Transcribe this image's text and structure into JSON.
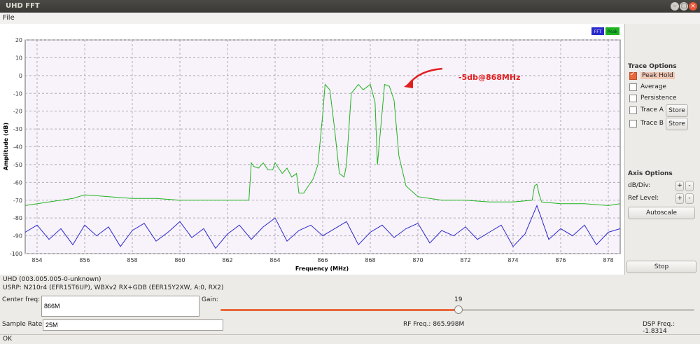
{
  "window": {
    "title": "UHD FFT"
  },
  "menu": {
    "file": "File"
  },
  "plot": {
    "legend": {
      "fft": "FFT",
      "peak": "Peak"
    },
    "annotation": "-5db@868MHz",
    "colors": {
      "fft": "#2a2acc",
      "peak": "#1fb41f",
      "annotation": "#e02020"
    }
  },
  "chart_data": {
    "type": "line",
    "xlabel": "Frequency (MHz)",
    "ylabel": "Amplitude (dB)",
    "xlim": [
      853.5,
      878.5
    ],
    "ylim": [
      -100,
      20
    ],
    "xticks": [
      "854",
      "856",
      "858",
      "860",
      "862",
      "864",
      "866",
      "868",
      "870",
      "872",
      "874",
      "876",
      "878"
    ],
    "yticks": [
      "20",
      "10",
      "0",
      "-10",
      "-20",
      "-30",
      "-40",
      "-50",
      "-60",
      "-70",
      "-80",
      "-90",
      "-100"
    ],
    "grid": true,
    "legend_position": "top-right",
    "series": [
      {
        "name": "Peak",
        "x": [
          853.5,
          854.5,
          855.5,
          856,
          857,
          858,
          859,
          860,
          861,
          862,
          862.9,
          863,
          863.1,
          863.3,
          863.5,
          863.7,
          863.9,
          864,
          864.1,
          864.3,
          864.5,
          864.7,
          864.9,
          865,
          865.2,
          865.4,
          865.6,
          865.8,
          866,
          866.1,
          866.3,
          866.5,
          866.7,
          866.9,
          867,
          867.2,
          867.5,
          867.7,
          868,
          868.2,
          868.3,
          868.6,
          868.8,
          869,
          869.2,
          869.5,
          870,
          871,
          872,
          873,
          874,
          874.8,
          874.9,
          875,
          875.1,
          875.2,
          876,
          877,
          878,
          878.5
        ],
        "y": [
          -73,
          -71,
          -69,
          -67,
          -68,
          -69,
          -69,
          -70,
          -70,
          -70,
          -70,
          -49,
          -51,
          -52,
          -49,
          -53,
          -53,
          -49,
          -51,
          -55,
          -52,
          -57,
          -55,
          -66,
          -66,
          -62,
          -58,
          -50,
          -22,
          -5,
          -8,
          -30,
          -55,
          -57,
          -50,
          -10,
          -5,
          -8,
          -5,
          -15,
          -50,
          -5,
          -6,
          -14,
          -45,
          -62,
          -68,
          -70,
          -70,
          -71,
          -71,
          -70,
          -62,
          -61,
          -67,
          -71,
          -72,
          -72,
          -73,
          -72
        ]
      },
      {
        "name": "FFT",
        "x": [
          853.5,
          854,
          854.5,
          855,
          855.5,
          856,
          856.5,
          857,
          857.5,
          858,
          858.5,
          859,
          859.5,
          860,
          860.5,
          861,
          861.5,
          862,
          862.5,
          863,
          863.5,
          864,
          864.5,
          865,
          865.5,
          866,
          866.5,
          867,
          867.5,
          868,
          868.5,
          869,
          869.5,
          870,
          870.5,
          871,
          871.5,
          872,
          872.5,
          873,
          873.5,
          874,
          874.5,
          875,
          875.5,
          876,
          876.5,
          877,
          877.5,
          878,
          878.5
        ],
        "y": [
          -88,
          -84,
          -92,
          -86,
          -95,
          -84,
          -90,
          -85,
          -96,
          -87,
          -83,
          -93,
          -88,
          -82,
          -91,
          -86,
          -97,
          -89,
          -84,
          -92,
          -85,
          -80,
          -93,
          -87,
          -84,
          -90,
          -86,
          -82,
          -95,
          -88,
          -84,
          -91,
          -86,
          -83,
          -94,
          -87,
          -90,
          -85,
          -92,
          -88,
          -84,
          -96,
          -89,
          -73,
          -92,
          -86,
          -90,
          -84,
          -95,
          -88,
          -86
        ]
      }
    ]
  },
  "panel": {
    "trace_title": "Trace Options",
    "peak_hold": "Peak Hold",
    "average": "Average",
    "persistence": "Persistence",
    "trace_a": "Trace A",
    "trace_b": "Trace B",
    "store": "Store",
    "axis_title": "Axis Options",
    "db_div": "dB/Div:",
    "ref_level": "Ref Level:",
    "plus": "+",
    "minus": "-",
    "autoscale": "Autoscale",
    "stop": "Stop"
  },
  "info": {
    "uhd_version": "UHD (003.005.005-0-unknown)",
    "usrp": "USRP: N210r4 (EFR15T6UP), WBXv2 RX+GDB (EER15Y2XW, A:0, RX2)"
  },
  "controls": {
    "center_freq_label": "Center freq:",
    "center_freq_value": "866M",
    "gain_label": "Gain:",
    "gain_value": "19",
    "gain_fraction": 0.5,
    "sample_rate_label": "Sample Rate:",
    "sample_rate_value": "25M",
    "rf_freq": "RF Freq.: 865.998M",
    "dsp_freq": "DSP Freq.: -1.8314"
  },
  "status": {
    "text": "OK"
  }
}
